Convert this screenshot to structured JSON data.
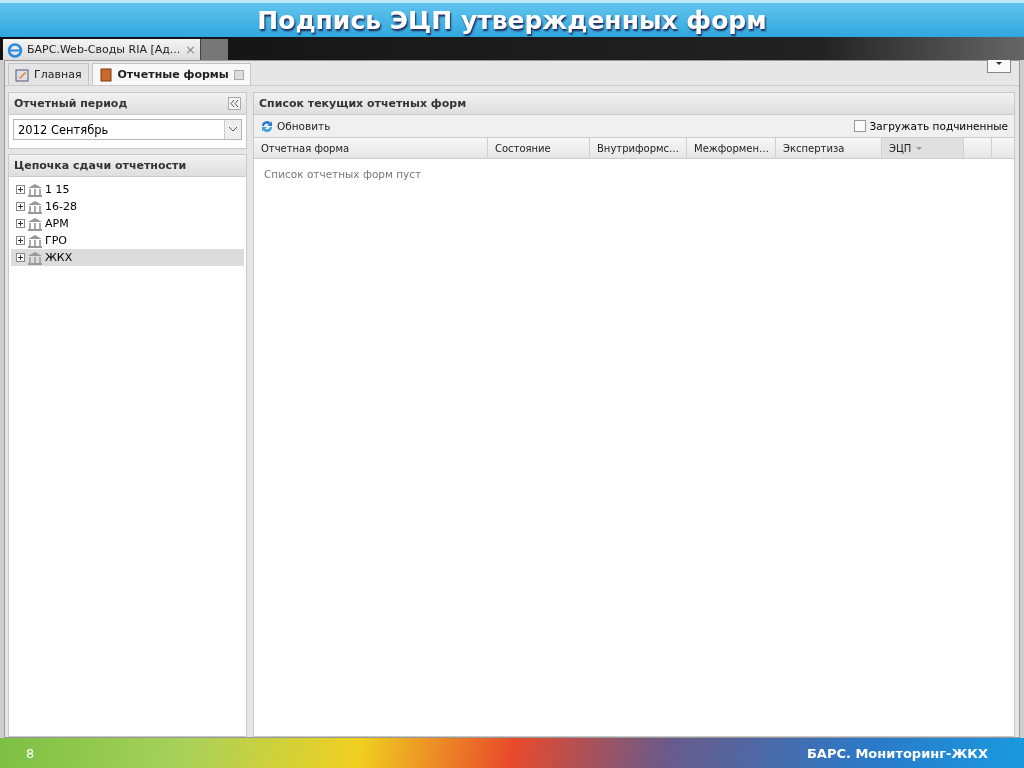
{
  "slide_title": "Подпись ЭЦП утвержденных форм",
  "browser_tab": {
    "title": "БАРС.Web-Своды RIA [Ад...",
    "close": "×"
  },
  "app_tabs": [
    {
      "label": "Главная",
      "selected": false,
      "closable": false
    },
    {
      "label": "Отчетные формы",
      "selected": true,
      "closable": true
    }
  ],
  "left_panel": {
    "period_title": "Отчетный период",
    "period_value": "2012 Сентябрь",
    "tree_title": "Цепочка сдачи отчетности",
    "tree": [
      {
        "label": "1 15",
        "selected": false
      },
      {
        "label": "16-28",
        "selected": false
      },
      {
        "label": "АРМ",
        "selected": false
      },
      {
        "label": "ГРО",
        "selected": false
      },
      {
        "label": "ЖКХ",
        "selected": true
      }
    ]
  },
  "right_panel": {
    "title": "Список текущих отчетных форм",
    "refresh": "Обновить",
    "load_subordinate": {
      "label": "Загружать подчиненные",
      "checked": false
    },
    "columns": [
      {
        "label": "Отчетная форма",
        "sorted": false
      },
      {
        "label": "Состояние",
        "sorted": false
      },
      {
        "label": "Внутриформс…",
        "sorted": false
      },
      {
        "label": "Межформен…",
        "sorted": false
      },
      {
        "label": "Экспертиза",
        "sorted": false
      },
      {
        "label": "ЭЦП",
        "sorted": true
      }
    ],
    "empty_text": "Список отчетных форм пуст"
  },
  "footer": {
    "page": "8",
    "brand": "БАРС. Мониторинг-ЖКХ"
  }
}
